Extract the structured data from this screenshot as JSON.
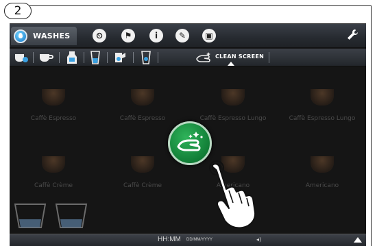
{
  "step": {
    "number": "2"
  },
  "header": {
    "active_tab": {
      "label": "WASHES",
      "icon": "water-drop-icon"
    },
    "tabs": [
      {
        "icon": "clock-icon",
        "glyph": "⏲"
      },
      {
        "icon": "flag-icon",
        "glyph": "⚑"
      },
      {
        "icon": "info-icon",
        "glyph": "i"
      },
      {
        "icon": "pencil-icon",
        "glyph": "✎"
      },
      {
        "icon": "coffee-machine-icon",
        "glyph": "▣"
      }
    ],
    "settings_icon": "wrench-icon"
  },
  "toolbar": {
    "items": [
      {
        "icon": "cup-rinse-icon"
      },
      {
        "icon": "cup-icon"
      },
      {
        "icon": "milk-carton-icon"
      },
      {
        "icon": "glass-icon"
      },
      {
        "icon": "jug-pour-icon"
      },
      {
        "icon": "glass-drop-icon"
      },
      {
        "icon": "hand-wipe-icon"
      }
    ],
    "clean_screen_label": "CLEAN SCREEN"
  },
  "products": {
    "row1": [
      "Caffè Espresso",
      "Caffè Espresso",
      "Caffè Espresso Lungo",
      "Caffè Espresso Lungo"
    ],
    "row2": [
      "Caffè Crème",
      "Caffè Crème",
      "Americano",
      "Americano"
    ]
  },
  "status": {
    "time": "HH:MM",
    "date": "DD/MM/YYYY",
    "volume_icon": "speaker-icon",
    "expand_icon": "up-arrow-icon"
  },
  "colors": {
    "accent_green": "#1a9a47",
    "active_tab_blue": "#1a78c8"
  }
}
